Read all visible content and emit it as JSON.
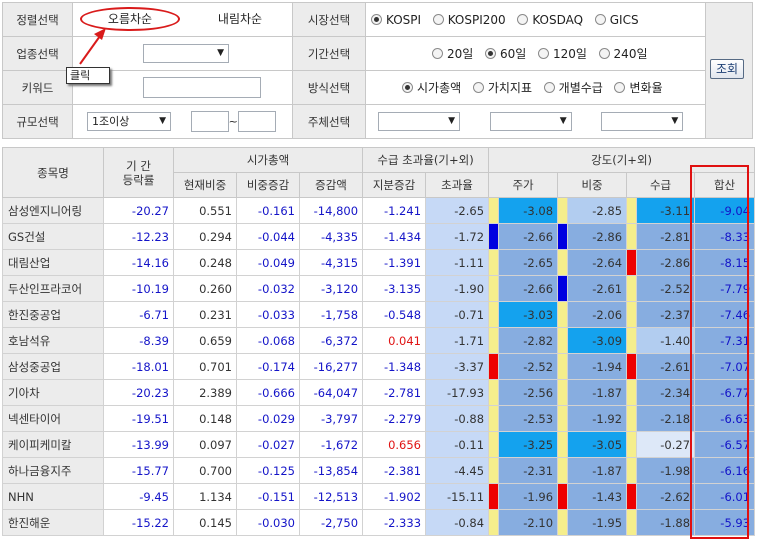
{
  "filters": {
    "sort_label": "정렬선택",
    "sort_asc": "오름차순",
    "sort_desc": "내림차순",
    "market_label": "시장선택",
    "markets": [
      "KOSPI",
      "KOSPI200",
      "KOSDAQ",
      "GICS"
    ],
    "market_selected": 0,
    "industry_label": "업종선택",
    "industry_value": "",
    "period_label": "기간선택",
    "periods": [
      "20일",
      "60일",
      "120일",
      "240일"
    ],
    "period_selected": 1,
    "keyword_label": "키워드",
    "keyword_value": "",
    "tooltip": "클릭",
    "method_label": "방식선택",
    "methods": [
      "시가총액",
      "가치지표",
      "개별수급",
      "변화율"
    ],
    "method_selected": 0,
    "size_label": "규모선택",
    "size_value": "1조이상",
    "range_sep": "~",
    "range_from": "",
    "range_to": "",
    "subject_label": "주체선택",
    "subject_values": [
      "",
      "",
      ""
    ],
    "query_button": "조회"
  },
  "table": {
    "headers": {
      "name": "종목명",
      "period_rate": "기  간\n등락률",
      "mcap": "시가총액",
      "mcap_cur": "현재비중",
      "mcap_chg": "비중증감",
      "mcap_amt": "증감액",
      "supply": "수급 초과율(기+외)",
      "supply_share": "지분증감",
      "supply_excess": "초과율",
      "strength": "강도(기+외)",
      "str_price": "주가",
      "str_weight": "비중",
      "str_supply": "수급",
      "str_total": "합산"
    },
    "rows": [
      {
        "name": "삼성엔지니어링",
        "rate": "-20.27",
        "cur": "0.551",
        "chg": "-0.161",
        "amt": "-14,800",
        "share": "-1.241",
        "excess": "-2.65",
        "f1": "yellow",
        "price": "-3.08",
        "pl": "3",
        "f2": "yellow",
        "weight": "-2.85",
        "wl": "1",
        "f3": "yellow",
        "supply": "-3.11",
        "sl": "3",
        "total": "-9.04",
        "tl": "3"
      },
      {
        "name": "GS건설",
        "rate": "-12.23",
        "cur": "0.294",
        "chg": "-0.044",
        "amt": "-4,335",
        "share": "-1.434",
        "excess": "-1.72",
        "f1": "blue",
        "price": "-2.66",
        "pl": "2",
        "f2": "blue",
        "weight": "-2.86",
        "wl": "2",
        "f3": "yellow",
        "supply": "-2.81",
        "sl": "2",
        "total": "-8.33",
        "tl": "2"
      },
      {
        "name": "대림산업",
        "rate": "-14.16",
        "cur": "0.248",
        "chg": "-0.049",
        "amt": "-4,315",
        "share": "-1.391",
        "excess": "-1.11",
        "f1": "yellow",
        "price": "-2.65",
        "pl": "2",
        "f2": "yellow",
        "weight": "-2.64",
        "wl": "2",
        "f3": "red",
        "supply": "-2.86",
        "sl": "2",
        "total": "-8.15",
        "tl": "2"
      },
      {
        "name": "두산인프라코어",
        "rate": "-10.19",
        "cur": "0.260",
        "chg": "-0.032",
        "amt": "-3,120",
        "share": "-3.135",
        "excess": "-1.90",
        "f1": "yellow",
        "price": "-2.66",
        "pl": "2",
        "f2": "blue",
        "weight": "-2.61",
        "wl": "2",
        "f3": "yellow",
        "supply": "-2.52",
        "sl": "2",
        "total": "-7.79",
        "tl": "2"
      },
      {
        "name": "한진중공업",
        "rate": "-6.71",
        "cur": "0.231",
        "chg": "-0.033",
        "amt": "-1,758",
        "share": "-0.548",
        "excess": "-0.71",
        "f1": "yellow",
        "price": "-3.03",
        "pl": "3",
        "f2": "yellow",
        "weight": "-2.06",
        "wl": "2",
        "f3": "yellow",
        "supply": "-2.37",
        "sl": "2",
        "total": "-7.46",
        "tl": "2"
      },
      {
        "name": "호남석유",
        "rate": "-8.39",
        "cur": "0.659",
        "chg": "-0.068",
        "amt": "-6,372",
        "share": "0.041",
        "excess": "-1.71",
        "f1": "yellow",
        "price": "-2.82",
        "pl": "2",
        "f2": "yellow",
        "weight": "-3.09",
        "wl": "3",
        "f3": "yellow",
        "supply": "-1.40",
        "sl": "1",
        "total": "-7.31",
        "tl": "2"
      },
      {
        "name": "삼성중공업",
        "rate": "-18.01",
        "cur": "0.701",
        "chg": "-0.174",
        "amt": "-16,277",
        "share": "-1.348",
        "excess": "-3.37",
        "f1": "red",
        "price": "-2.52",
        "pl": "2",
        "f2": "yellow",
        "weight": "-1.94",
        "wl": "2",
        "f3": "red",
        "supply": "-2.61",
        "sl": "2",
        "total": "-7.07",
        "tl": "2"
      },
      {
        "name": "기아차",
        "rate": "-20.23",
        "cur": "2.389",
        "chg": "-0.666",
        "amt": "-64,047",
        "share": "-2.781",
        "excess": "-17.93",
        "f1": "yellow",
        "price": "-2.56",
        "pl": "2",
        "f2": "yellow",
        "weight": "-1.87",
        "wl": "2",
        "f3": "yellow",
        "supply": "-2.34",
        "sl": "2",
        "total": "-6.77",
        "tl": "2"
      },
      {
        "name": "넥센타이어",
        "rate": "-19.51",
        "cur": "0.148",
        "chg": "-0.029",
        "amt": "-3,797",
        "share": "-2.279",
        "excess": "-0.88",
        "f1": "yellow",
        "price": "-2.53",
        "pl": "2",
        "f2": "yellow",
        "weight": "-1.92",
        "wl": "2",
        "f3": "yellow",
        "supply": "-2.18",
        "sl": "2",
        "total": "-6.63",
        "tl": "2"
      },
      {
        "name": "케이피케미칼",
        "rate": "-13.99",
        "cur": "0.097",
        "chg": "-0.027",
        "amt": "-1,672",
        "share": "0.656",
        "excess": "-0.11",
        "f1": "yellow",
        "price": "-3.25",
        "pl": "3",
        "f2": "yellow",
        "weight": "-3.05",
        "wl": "3",
        "f3": "yellow",
        "supply": "-0.27",
        "sl": "0",
        "total": "-6.57",
        "tl": "2"
      },
      {
        "name": "하나금융지주",
        "rate": "-15.77",
        "cur": "0.700",
        "chg": "-0.125",
        "amt": "-13,854",
        "share": "-2.381",
        "excess": "-4.45",
        "f1": "yellow",
        "price": "-2.31",
        "pl": "2",
        "f2": "yellow",
        "weight": "-1.87",
        "wl": "2",
        "f3": "yellow",
        "supply": "-1.98",
        "sl": "2",
        "total": "-6.16",
        "tl": "2"
      },
      {
        "name": "NHN",
        "rate": "-9.45",
        "cur": "1.134",
        "chg": "-0.151",
        "amt": "-12,513",
        "share": "-1.902",
        "excess": "-15.11",
        "f1": "red",
        "price": "-1.96",
        "pl": "2",
        "f2": "red",
        "weight": "-1.43",
        "wl": "2",
        "f3": "red",
        "supply": "-2.62",
        "sl": "2",
        "total": "-6.01",
        "tl": "2"
      },
      {
        "name": "한진해운",
        "rate": "-15.22",
        "cur": "0.145",
        "chg": "-0.030",
        "amt": "-2,750",
        "share": "-2.333",
        "excess": "-0.84",
        "f1": "yellow",
        "price": "-2.10",
        "pl": "2",
        "f2": "yellow",
        "weight": "-1.95",
        "wl": "2",
        "f3": "yellow",
        "supply": "-1.88",
        "sl": "2",
        "total": "-5.93",
        "tl": "2"
      }
    ]
  },
  "colors": {
    "level0": "#dde8f8",
    "level1": "#b2cdf0",
    "level2": "#87ade0",
    "level3": "#14a2ee",
    "flag_yellow": "#f5ee8c",
    "flag_blue": "#0000e0",
    "flag_red": "#ee0000",
    "highlight": "#e01010"
  }
}
